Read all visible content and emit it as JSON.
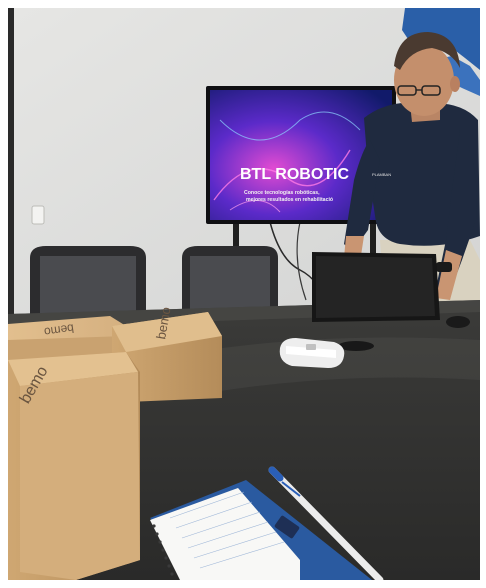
{
  "scene": {
    "tv": {
      "title": "BTL ROBOTIC",
      "subtitle_line1": "Conoce tecnologías robóticas,",
      "subtitle_line2": "mejores resultados en rehabilitació"
    },
    "boxes": {
      "brand": "bemo"
    },
    "shirt": {
      "logo": "PLAMBAN"
    }
  }
}
